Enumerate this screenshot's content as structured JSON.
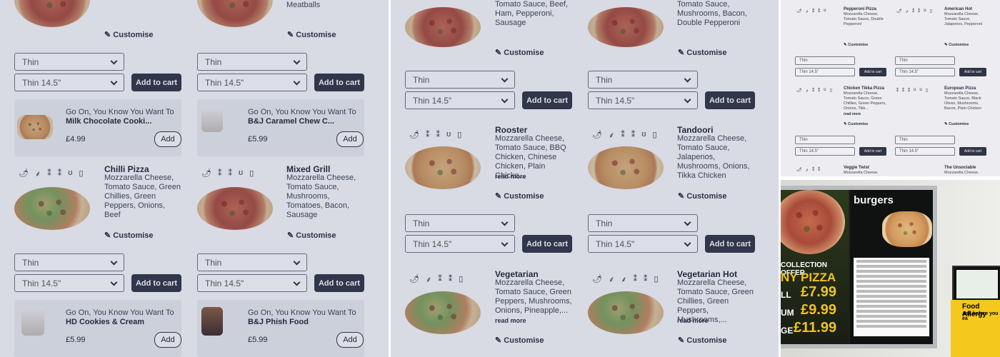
{
  "common": {
    "base": "Thin",
    "size": "Thin 14.5\"",
    "add_to_cart": "Add to cart",
    "customise": "Customise",
    "read_more": "read more",
    "add": "Add",
    "upsell_title": "Go On, You Know You Want To"
  },
  "panel1": {
    "top_desc_right": "Meatballs",
    "upsell_row1": [
      {
        "name": "Milk Chocolate Cooki...",
        "price": "£4.99"
      },
      {
        "name": "B&J Caramel Chew C...",
        "price": "£5.99"
      }
    ],
    "pizzas": [
      {
        "name": "Chilli Pizza",
        "desc": "Mozzarella Cheese, Tomato Sauce, Green Chillies, Green Peppers, Onions, Beef"
      },
      {
        "name": "Mixed Grill",
        "desc": "Mozzarella Cheese, Tomato Sauce, Mushrooms, Tomatoes, Bacon, Sausage"
      }
    ],
    "upsell_row2": [
      {
        "name": "HD Cookies & Cream",
        "price": "£5.99"
      },
      {
        "name": "B&J Phish Food",
        "price": "£5.99"
      }
    ]
  },
  "panel2": {
    "top_desc_left": "Tomato Sauce, Beef, Ham, Pepperoni, Sausage",
    "top_desc_right": "Tomato Sauce, Mushrooms, Bacon, Double Pepperoni",
    "pizzas": [
      {
        "name": "Rooster",
        "desc": "Mozzarella Cheese, Tomato Sauce, BBQ Chicken, Chinese Chicken, Plain Chicke..."
      },
      {
        "name": "Tandoori",
        "desc": "Mozzarella Cheese, Tomato Sauce, Jalapenos, Mushrooms, Onions, Tikka Chicken"
      },
      {
        "name": "Vegetarian",
        "desc": "Mozzarella Cheese, Tomato Sauce, Green Peppers, Mushrooms, Onions, Pineapple,..."
      },
      {
        "name": "Vegetarian Hot",
        "desc": "Mozzarella Cheese, Tomato Sauce, Green Chillies, Green Peppers, Mushrooms,..."
      }
    ]
  },
  "panel3": {
    "pizzas": [
      {
        "name": "Pepperoni Pizza",
        "desc": "Mozzarella Cheese, Tomato Sauce, Double Pepperoni"
      },
      {
        "name": "American Hot",
        "desc": "Mozzarella Cheese, Tomato Sauce, Jalapenos, Pepperoni"
      },
      {
        "name": "Chicken Tikka Pizza",
        "desc": "Mozzarella Cheese, Tomato Sauce, Green Chillies, Green Peppers, Onions, Tikk..."
      },
      {
        "name": "European Pizza",
        "desc": "Mozzarella Cheese, Tomato Sauce, Black Olives, Mushrooms, Bacon, Plain Chicken"
      },
      {
        "name": "Veggie Twist",
        "desc": "Mozzarella Cheese,"
      },
      {
        "name": "The Unsociable",
        "desc": "Mozzarella Cheese,"
      }
    ]
  },
  "photo": {
    "offer": "COLLECTION OFFER",
    "any_pizza": "NY PIZZA",
    "price1": "£7.99",
    "price2": "£9.99",
    "price3": "£11.99",
    "side1": "LL",
    "side2": "UM",
    "side3": "GE",
    "burgers": "burgers",
    "allergy_title": "Food Allergy",
    "allergy_sub": "Ask before you ea"
  }
}
